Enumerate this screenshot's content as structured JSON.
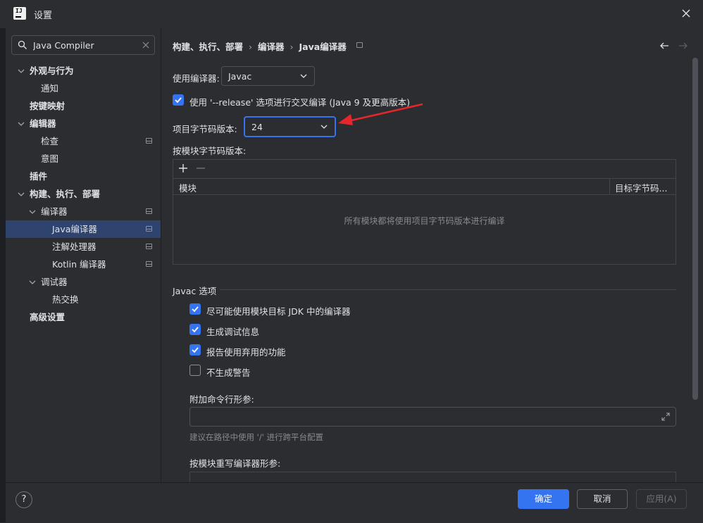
{
  "window": {
    "title": "设置"
  },
  "search": {
    "value": "Java Compiler"
  },
  "sidebar": {
    "items": [
      {
        "label": "外观与行为"
      },
      {
        "label": "通知"
      },
      {
        "label": "按键映射"
      },
      {
        "label": "编辑器"
      },
      {
        "label": "检查"
      },
      {
        "label": "意图"
      },
      {
        "label": "插件"
      },
      {
        "label": "构建、执行、部署"
      },
      {
        "label": "编译器"
      },
      {
        "label": "Java编译器"
      },
      {
        "label": "注解处理器"
      },
      {
        "label": "Kotlin 编译器"
      },
      {
        "label": "调试器"
      },
      {
        "label": "热交换"
      },
      {
        "label": "高级设置"
      }
    ]
  },
  "breadcrumb": {
    "part1": "构建、执行、部署",
    "part2": "编译器",
    "part3": "Java编译器"
  },
  "compiler": {
    "label": "使用编译器:",
    "value": "Javac"
  },
  "release": {
    "label": "使用 '--release' 选项进行交叉编译 (Java 9 及更高版本)",
    "checked": true
  },
  "bytecode": {
    "label": "项目字节码版本:",
    "value": "24"
  },
  "per_module": {
    "label": "按模块字节码版本:",
    "col_module": "模块",
    "col_target": "目标字节码...",
    "empty_text": "所有模块都将使用项目字节码版本进行编译"
  },
  "javac": {
    "section_title": "Javac 选项",
    "opt1": "尽可能使用模块目标 JDK 中的编译器",
    "opt2": "生成调试信息",
    "opt3": "报告使用弃用的功能",
    "opt4": "不生成警告",
    "extra_args_label": "附加命令行形参:",
    "hint": "建议在路径中使用 '/' 进行跨平台配置",
    "override_label": "按模块重写编译器形参:"
  },
  "footer": {
    "help": "?",
    "ok": "确定",
    "cancel": "取消",
    "apply": "应用(A)"
  },
  "colors": {
    "accent": "#3574f0",
    "annotation": "#e5262a",
    "selection": "#2e436e"
  }
}
